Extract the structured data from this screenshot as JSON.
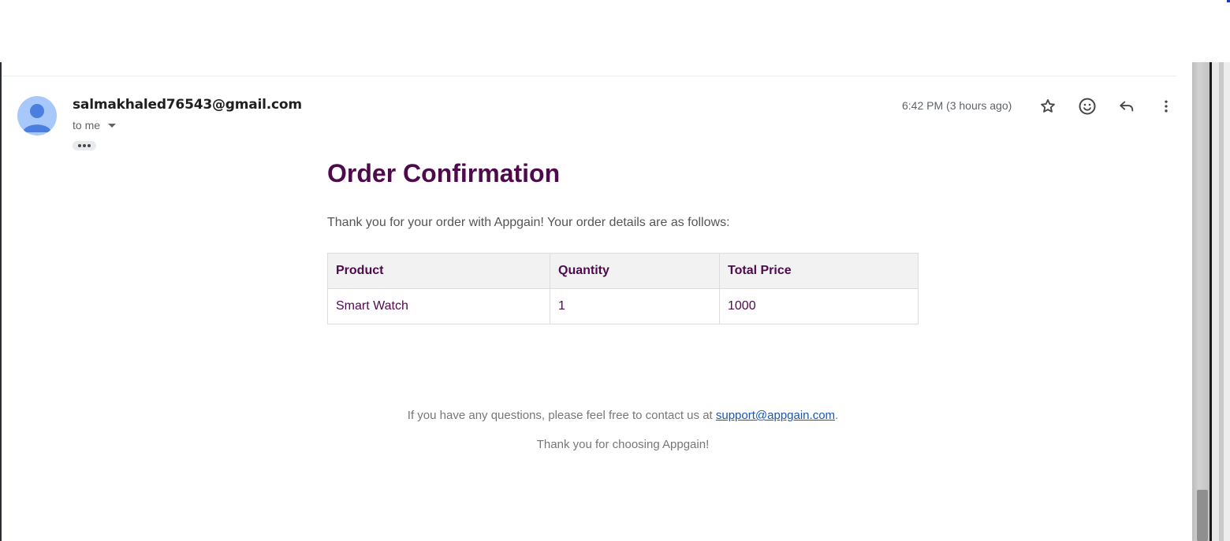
{
  "email": {
    "sender": "salmakhaled76543@gmail.com",
    "recipient_label": "to me",
    "timestamp": "6:42 PM (3 hours ago)"
  },
  "actions": {
    "star_icon": "star-icon",
    "emoji_icon": "emoji-icon",
    "reply_icon": "reply-icon",
    "more_icon": "more-vert-icon"
  },
  "body": {
    "title": "Order Confirmation",
    "intro": "Thank you for your order with Appgain! Your order details are as follows:",
    "table": {
      "headers": [
        "Product",
        "Quantity",
        "Total Price"
      ],
      "rows": [
        [
          "Smart Watch",
          "1",
          "1000"
        ]
      ]
    },
    "contact_prefix": "If you have any questions, please feel free to contact us at ",
    "contact_email": "support@appgain.com",
    "contact_suffix": ".",
    "closing": "Thank you for choosing Appgain!"
  },
  "colors": {
    "title": "#4e0a4d",
    "avatar": "#a8c7fa",
    "link": "#1a56b4"
  }
}
